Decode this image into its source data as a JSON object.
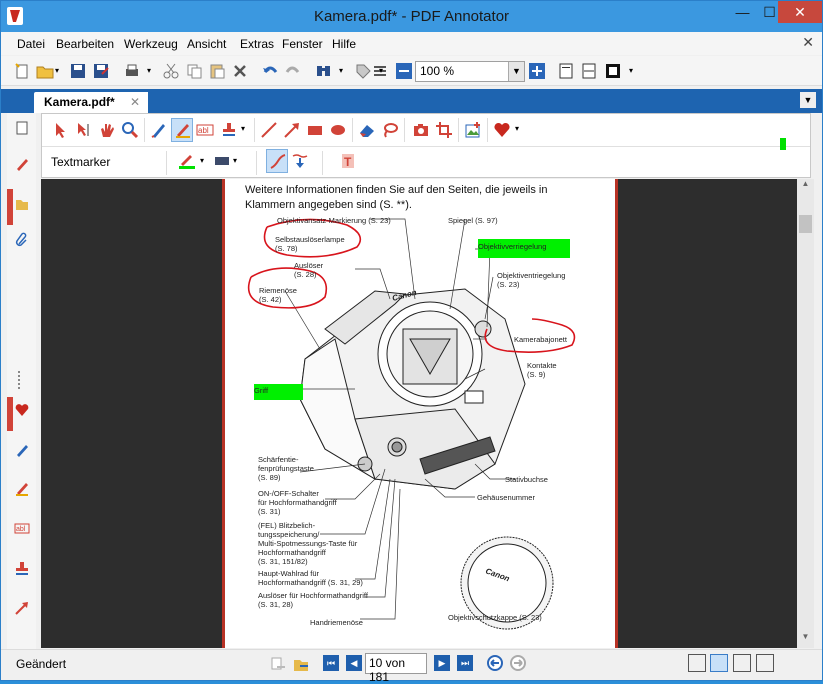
{
  "window": {
    "title": "Kamera.pdf* - PDF Annotator"
  },
  "menu": [
    "Datei",
    "Bearbeiten",
    "Werkzeug",
    "Ansicht",
    "Extras",
    "Fenster",
    "Hilfe"
  ],
  "toolbar": {
    "zoom_value": "100 %"
  },
  "tabs": [
    {
      "label": "Kamera.pdf*"
    }
  ],
  "annotation_bar": {
    "tool_label": "Textmarker",
    "accent_color": "#d14338",
    "marker_color": "#00e000"
  },
  "document": {
    "intro_text": "Weitere Informationen finden Sie auf den Seiten, die jeweils in Klammern angegeben sind (S. **).",
    "labels": {
      "objektivansatz": "Objektivansatz-Markierung (S. 23)",
      "spiegel": "Spiegel (S. 97)",
      "selbstausloeser": "Selbstauslöserlampe\n(S. 78)",
      "objektivverriegelung": "Objektivverriegelung",
      "ausloeser": "Auslöser\n(S. 28)",
      "objektiventriegelung": "Objektiventriegelung\n(S. 23)",
      "riemenoese": "Riemenöse\n(S. 42)",
      "kamerabajonett": "Kamerabajonett",
      "kontakte": "Kontakte\n(S. 9)",
      "griff": "Griff",
      "schaerfentiefe": "Schärfentie-\nfenprüfungstaste\n(S. 89)",
      "stativbuchse": "Stativbuchse",
      "onoff": "ON-/OFF-Schalter\nfür Hochformathandgriff\n(S. 31)",
      "gehaeusenummer": "Gehäusenummer",
      "fel": "(FEL) Blitzbelich-\ntungsspeicherung/\nMulti-Spotmessungs-Taste für\nHochformathandgriff\n(S. 31, 151/82)",
      "hauptwahlrad": "Haupt-Wahlrad für\nHochformathandgriff (S. 31, 29)",
      "ausloeser_hoch": "Auslöser für Hochformathandgriff\n(S. 31, 28)",
      "handriemenoese": "Handriemenöse",
      "objektivschutzkappe": "Objektivschutzkappe (S. 23)",
      "canon": "Canon"
    }
  },
  "status": {
    "text": "Geändert",
    "page_indicator": "10 von 181"
  }
}
